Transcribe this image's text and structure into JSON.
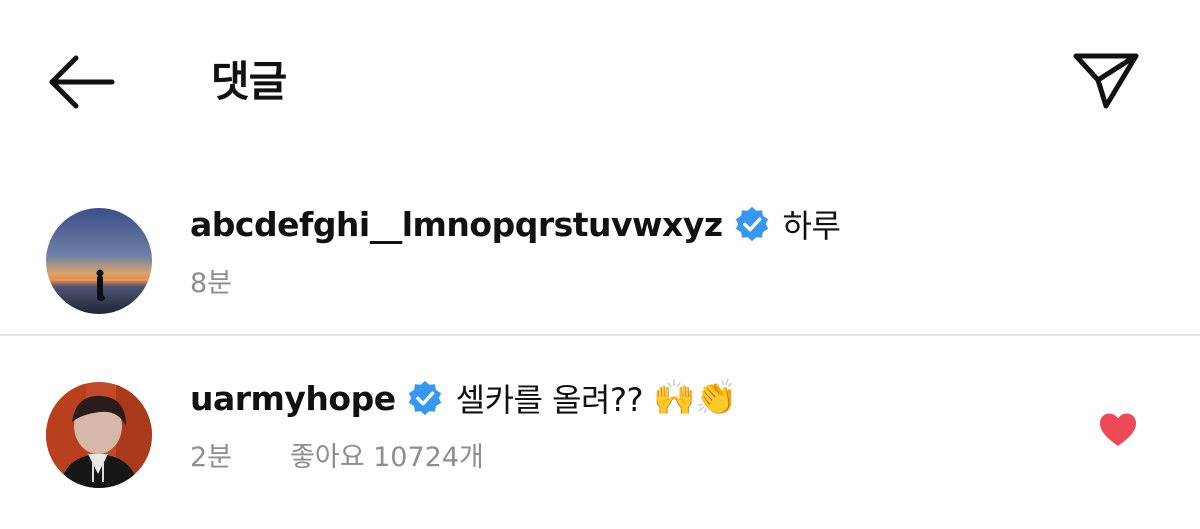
{
  "header": {
    "title": "댓글",
    "back_icon": "arrow-left-icon",
    "send_icon": "paper-plane-icon"
  },
  "comments": [
    {
      "username": "abcdefghi__lmnopqrstuvwxyz",
      "verified": true,
      "text": "하루",
      "time": "8분",
      "avatar": "sunset-beach-silhouette"
    },
    {
      "username": "uarmyhope",
      "verified": true,
      "text": "셀카를 올려??",
      "emoji": "🙌👏",
      "time": "2분",
      "likes": "좋아요 10724개",
      "liked": true,
      "avatar": "person-photo"
    }
  ],
  "colors": {
    "verified_badge": "#3897f0",
    "heart": "#ed4956",
    "secondary_text": "#8e8e8e",
    "divider": "#e4e4e4"
  }
}
